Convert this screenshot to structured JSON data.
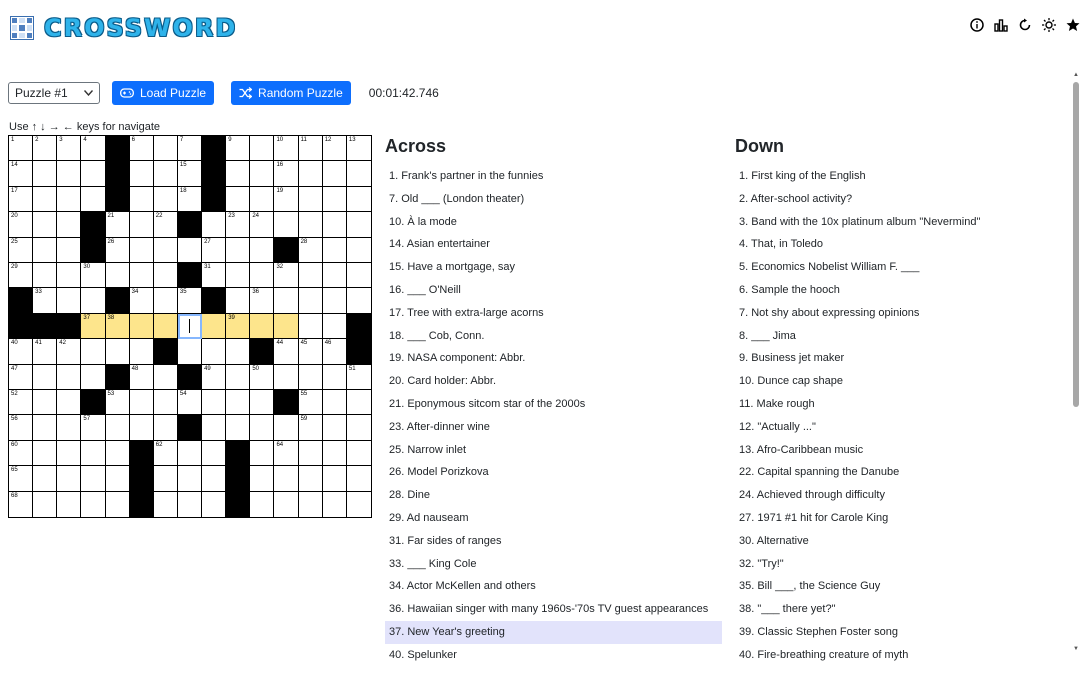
{
  "app": {
    "title": "CROSSWORD"
  },
  "header": {
    "icons": [
      "info-icon",
      "stats-icon",
      "refresh-icon",
      "theme-icon",
      "star-icon"
    ]
  },
  "controls": {
    "puzzle_select": "Puzzle #1",
    "load_label": "Load Puzzle",
    "random_label": "Random Puzzle",
    "timer": "00:01:42.746"
  },
  "hint": "Use ↑ ↓ → ← keys for navigate",
  "grid": {
    "rows": [
      "....#...#......",
      "....#...#......",
      "....#...#......",
      "...#...#.......",
      "...#.......#...",
      ".......#.......",
      "#...#...#......",
      "###...........#",
      "......#...#...#",
      "....#..#.......",
      "...#.......#...",
      ".......#.......",
      ".....#...#.....",
      ".....#...#.....",
      ".....#...#....."
    ],
    "numbers": [
      [
        0,
        0,
        "1"
      ],
      [
        0,
        1,
        "2"
      ],
      [
        0,
        2,
        "3"
      ],
      [
        0,
        3,
        "4"
      ],
      [
        0,
        4,
        "5"
      ],
      [
        0,
        5,
        "6"
      ],
      [
        0,
        7,
        "7"
      ],
      [
        0,
        8,
        "8"
      ],
      [
        0,
        9,
        "9"
      ],
      [
        0,
        11,
        "10"
      ],
      [
        0,
        12,
        "11"
      ],
      [
        0,
        13,
        "12"
      ],
      [
        0,
        14,
        "13"
      ],
      [
        1,
        0,
        "14"
      ],
      [
        1,
        7,
        "15"
      ],
      [
        1,
        11,
        "16"
      ],
      [
        2,
        0,
        "17"
      ],
      [
        2,
        7,
        "18"
      ],
      [
        2,
        11,
        "19"
      ],
      [
        3,
        0,
        "20"
      ],
      [
        3,
        4,
        "21"
      ],
      [
        3,
        6,
        "22"
      ],
      [
        3,
        9,
        "23"
      ],
      [
        3,
        10,
        "24"
      ],
      [
        4,
        0,
        "25"
      ],
      [
        4,
        4,
        "26"
      ],
      [
        4,
        8,
        "27"
      ],
      [
        4,
        12,
        "28"
      ],
      [
        5,
        0,
        "29"
      ],
      [
        5,
        3,
        "30"
      ],
      [
        5,
        8,
        "31"
      ],
      [
        5,
        11,
        "32"
      ],
      [
        6,
        1,
        "33"
      ],
      [
        6,
        5,
        "34"
      ],
      [
        6,
        7,
        "35"
      ],
      [
        6,
        10,
        "36"
      ],
      [
        7,
        3,
        "37"
      ],
      [
        7,
        4,
        "38"
      ],
      [
        7,
        9,
        "39"
      ],
      [
        8,
        0,
        "40"
      ],
      [
        8,
        1,
        "41"
      ],
      [
        8,
        2,
        "42"
      ],
      [
        8,
        6,
        "43"
      ],
      [
        8,
        11,
        "44"
      ],
      [
        8,
        12,
        "45"
      ],
      [
        8,
        13,
        "46"
      ],
      [
        9,
        0,
        "47"
      ],
      [
        9,
        5,
        "48"
      ],
      [
        9,
        8,
        "49"
      ],
      [
        9,
        10,
        "50"
      ],
      [
        9,
        14,
        "51"
      ],
      [
        10,
        0,
        "52"
      ],
      [
        10,
        4,
        "53"
      ],
      [
        10,
        7,
        "54"
      ],
      [
        10,
        12,
        "55"
      ],
      [
        11,
        0,
        "56"
      ],
      [
        11,
        3,
        "57"
      ],
      [
        11,
        7,
        "58"
      ],
      [
        11,
        12,
        "59"
      ],
      [
        12,
        0,
        "60"
      ],
      [
        12,
        5,
        "61"
      ],
      [
        12,
        6,
        "62"
      ],
      [
        12,
        9,
        "63"
      ],
      [
        12,
        11,
        "64"
      ],
      [
        13,
        0,
        "65"
      ],
      [
        13,
        5,
        "66"
      ],
      [
        13,
        9,
        "67"
      ],
      [
        14,
        0,
        "68"
      ],
      [
        14,
        5,
        "69"
      ],
      [
        14,
        9,
        "70"
      ]
    ],
    "highlight": {
      "row": 7,
      "from": 3,
      "to": 11
    },
    "selected": {
      "row": 7,
      "col": 7
    }
  },
  "across": {
    "title": "Across",
    "clues": [
      "1. Frank's partner in the funnies",
      "7. Old ___ (London theater)",
      "10. À la mode",
      "14. Asian entertainer",
      "15. Have a mortgage, say",
      "16. ___ O'Neill",
      "17. Tree with extra-large acorns",
      "18. ___ Cob, Conn.",
      "19. NASA component: Abbr.",
      "20. Card holder: Abbr.",
      "21. Eponymous sitcom star of the 2000s",
      "23. After-dinner wine",
      "25. Narrow inlet",
      "26. Model Porizkova",
      "28. Dine",
      "29. Ad nauseam",
      "31. Far sides of ranges",
      "33. ___ King Cole",
      "34. Actor McKellen and others",
      "36. Hawaiian singer with many 1960s-'70s TV guest appearances",
      "37. New Year's greeting",
      "40. Spelunker"
    ],
    "active_index": 20
  },
  "down": {
    "title": "Down",
    "clues": [
      "1. First king of the English",
      "2. After-school activity?",
      "3. Band with the 10x platinum album \"Nevermind\"",
      "4. That, in Toledo",
      "5. Economics Nobelist William F. ___",
      "6. Sample the hooch",
      "7. Not shy about expressing opinions",
      "8. ___ Jima",
      "9. Business jet maker",
      "10. Dunce cap shape",
      "11. Make rough",
      "12. \"Actually ...\"",
      "13. Afro-Caribbean music",
      "22. Capital spanning the Danube",
      "24. Achieved through difficulty",
      "27. 1971 #1 hit for Carole King",
      "30. Alternative",
      "32. \"Try!\"",
      "35. Bill ___, the Science Guy",
      "38. \"___ there yet?\"",
      "39. Classic Stephen Foster song",
      "40. Fire-breathing creature of myth"
    ]
  }
}
